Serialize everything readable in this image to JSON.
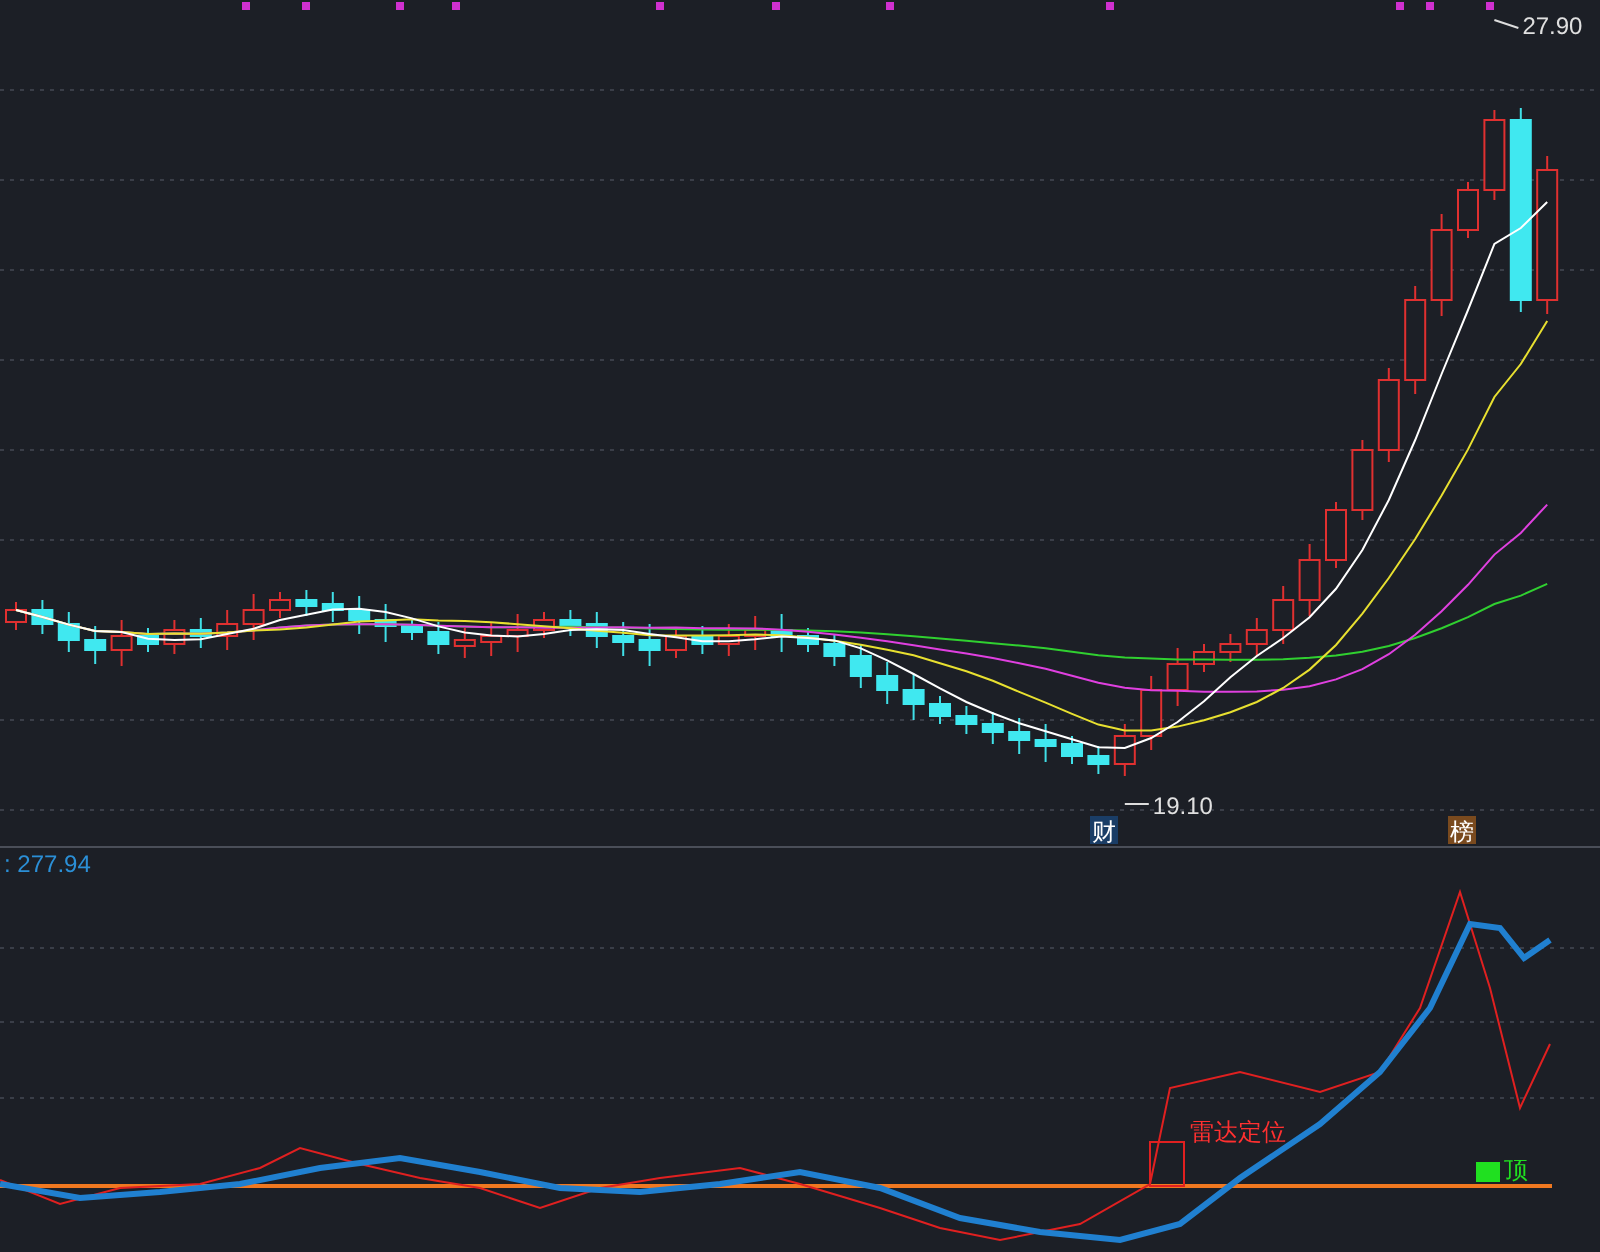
{
  "price_panel": {
    "high_label": "27.90",
    "low_label": "19.10",
    "event_markers": [
      {
        "text": "财",
        "color": "#1a3d66"
      },
      {
        "text": "榜",
        "color": "#7a4a1e"
      }
    ]
  },
  "indicator_panel": {
    "value_label": ": 277.94",
    "signals": [
      {
        "kind": "box",
        "text": "雷达定位"
      },
      {
        "kind": "flag",
        "text": "顶"
      }
    ]
  }
}
